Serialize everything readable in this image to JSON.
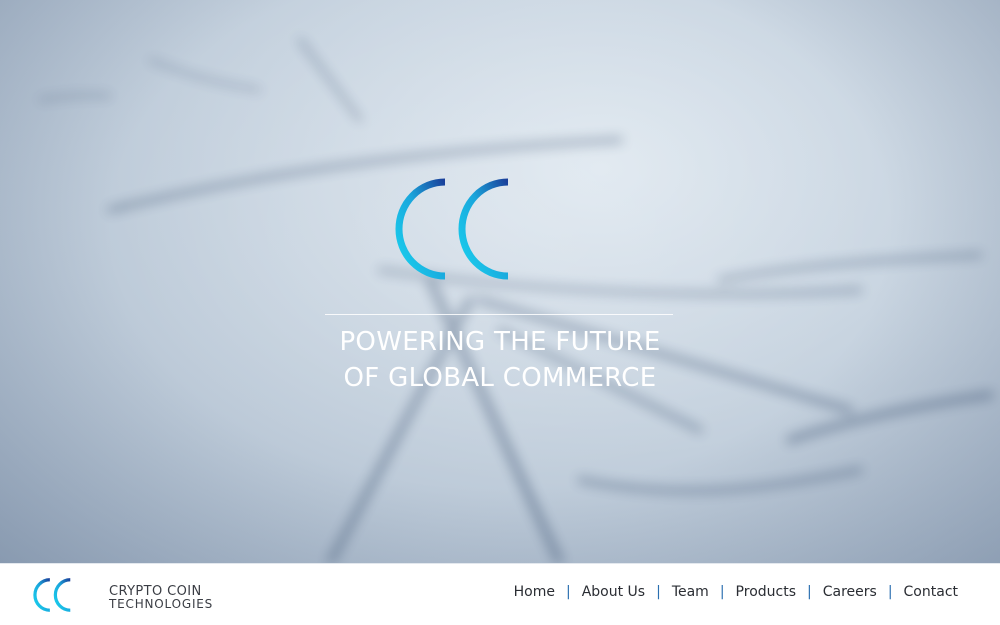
{
  "hero": {
    "logo_text": "CCT",
    "tagline_line1": "POWERING THE FUTURE",
    "tagline_line2": "OF GLOBAL COMMERCE"
  },
  "brand": {
    "mark": "CCT",
    "name_line1": "CRYPTO COIN",
    "name_line2": "TECHNOLOGIES"
  },
  "nav": {
    "items": [
      {
        "label": "Home"
      },
      {
        "label": "About Us"
      },
      {
        "label": "Team"
      },
      {
        "label": "Products"
      },
      {
        "label": "Careers"
      },
      {
        "label": "Contact"
      }
    ],
    "separator": "|"
  },
  "colors": {
    "logo_cyan": "#19c6e6",
    "logo_blue": "#1a4fa0",
    "separator": "#2a6fb0",
    "nav_text": "#2a2d33"
  }
}
